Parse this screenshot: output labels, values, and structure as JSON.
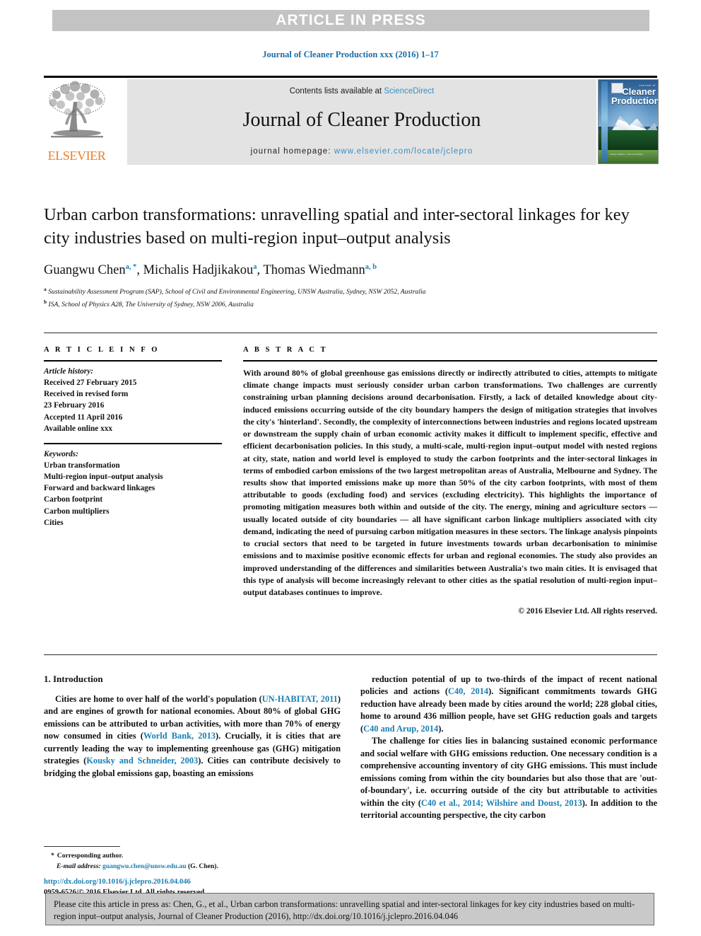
{
  "banner": {
    "text": "ARTICLE IN PRESS"
  },
  "running_head": "Journal of Cleaner Production xxx (2016) 1–17",
  "masthead": {
    "publisher_logo_label": "ELSEVIER",
    "contents_prefix": "Contents lists available at ",
    "contents_link": "ScienceDirect",
    "journal_name": "Journal of Cleaner Production",
    "homepage_prefix": "journal homepage: ",
    "homepage_url": "www.elsevier.com/locate/jclepro",
    "cover": {
      "eyebrow": "Journal of",
      "line1": "Cleaner",
      "line2": "Production",
      "footer_note": "Volume Summary  ·  Editorial Summary"
    }
  },
  "article": {
    "title": "Urban carbon transformations: unravelling spatial and inter-sectoral linkages for key city industries based on multi-region input–output analysis",
    "authors": [
      {
        "name": "Guangwu Chen",
        "marks": "a, *"
      },
      {
        "name": "Michalis Hadjikakou",
        "marks": "a"
      },
      {
        "name": "Thomas Wiedmann",
        "marks": "a, b"
      }
    ],
    "affiliations": [
      {
        "mark": "a",
        "text": "Sustainability Assessment Program (SAP), School of Civil and Environmental Engineering, UNSW Australia, Sydney, NSW 2052, Australia"
      },
      {
        "mark": "b",
        "text": "ISA, School of Physics A28, The University of Sydney, NSW 2006, Australia"
      }
    ]
  },
  "article_info": {
    "heading": "A R T I C L E  I N F O",
    "history_label": "Article history:",
    "history_lines": [
      "Received 27 February 2015",
      "Received in revised form",
      "23 February 2016",
      "Accepted 11 April 2016",
      "Available online xxx"
    ],
    "keywords_label": "Keywords:",
    "keywords": [
      "Urban transformation",
      "Multi-region input–output analysis",
      "Forward and backward linkages",
      "Carbon footprint",
      "Carbon multipliers",
      "Cities"
    ]
  },
  "abstract": {
    "heading": "A B S T R A C T",
    "text": "With around 80% of global greenhouse gas emissions directly or indirectly attributed to cities, attempts to mitigate climate change impacts must seriously consider urban carbon transformations. Two challenges are currently constraining urban planning decisions around decarbonisation. Firstly, a lack of detailed knowledge about city-induced emissions occurring outside of the city boundary hampers the design of mitigation strategies that involves the city's 'hinterland'. Secondly, the complexity of interconnections between industries and regions located upstream or downstream the supply chain of urban economic activity makes it difficult to implement specific, effective and efficient decarbonisation policies. In this study, a multi-scale, multi-region input–output model with nested regions at city, state, nation and world level is employed to study the carbon footprints and the inter-sectoral linkages in terms of embodied carbon emissions of the two largest metropolitan areas of Australia, Melbourne and Sydney. The results show that imported emissions make up more than 50% of the city carbon footprints, with most of them attributable to goods (excluding food) and services (excluding electricity). This highlights the importance of promoting mitigation measures both within and outside of the city. The energy, mining and agriculture sectors — usually located outside of city boundaries — all have significant carbon linkage multipliers associated with city demand, indicating the need of pursuing carbon mitigation measures in these sectors. The linkage analysis pinpoints to crucial sectors that need to be targeted in future investments towards urban decarbonisation to minimise emissions and to maximise positive economic effects for urban and regional economies. The study also provides an improved understanding of the differences and similarities between Australia's two main cities. It is envisaged that this type of analysis will become increasingly relevant to other cities as the spatial resolution of multi-region input–output databases continues to improve.",
    "copyright": "© 2016 Elsevier Ltd. All rights reserved."
  },
  "introduction": {
    "heading": "1. Introduction",
    "left_paragraph_1_parts": [
      {
        "t": "Cities are home to over half of the world's population (",
        "k": "plain"
      },
      {
        "t": "UN-HABITAT, 2011",
        "k": "cite"
      },
      {
        "t": ") and are engines of growth for national economies. About 80% of global GHG emissions can be attributed to urban activities, with more than 70% of energy now consumed in cities (",
        "k": "plain"
      },
      {
        "t": "World Bank, 2013",
        "k": "cite"
      },
      {
        "t": "). Crucially, it is cities that are currently leading the way to implementing greenhouse gas (GHG) mitigation strategies (",
        "k": "plain"
      },
      {
        "t": "Kousky and Schneider, 2003",
        "k": "cite"
      },
      {
        "t": "). Cities can contribute decisively to bridging the global emissions gap, boasting an emissions",
        "k": "plain"
      }
    ],
    "right_paragraph_1_parts": [
      {
        "t": "reduction potential of up to two-thirds of the impact of recent national policies and actions (",
        "k": "plain"
      },
      {
        "t": "C40, 2014",
        "k": "cite"
      },
      {
        "t": "). Significant commitments towards GHG reduction have already been made by cities around the world; 228 global cities, home to around 436 million people, have set GHG reduction goals and targets (",
        "k": "plain"
      },
      {
        "t": "C40 and Arup, 2014",
        "k": "cite"
      },
      {
        "t": ").",
        "k": "plain"
      }
    ],
    "right_paragraph_2_parts": [
      {
        "t": "The challenge for cities lies in balancing sustained economic performance and social welfare with GHG emissions reduction. One necessary condition is a comprehensive accounting inventory of city GHG emissions. This must include emissions coming from within the city boundaries but also those that are 'out-of-boundary', i.e. occurring outside of the city but attributable to activities within the city (",
        "k": "plain"
      },
      {
        "t": "C40 et al., 2014; Wilshire and Doust, 2013",
        "k": "cite"
      },
      {
        "t": "). In addition to the territorial accounting perspective, the city carbon",
        "k": "plain"
      }
    ]
  },
  "footnote": {
    "star": "*",
    "corresponding": "Corresponding author.",
    "email_label": "E-mail address:",
    "email": "guangwu.chen@unsw.edu.au",
    "email_suffix": "(G. Chen).",
    "doi_url": "http://dx.doi.org/10.1016/j.jclepro.2016.04.046",
    "issn_line": "0959-6526/© 2016 Elsevier Ltd. All rights reserved."
  },
  "cite_box": {
    "text": "Please cite this article in press as: Chen, G., et al., Urban carbon transformations: unravelling spatial and inter-sectoral linkages for key city industries based on multi-region input–output analysis, Journal of Cleaner Production (2016), http://dx.doi.org/10.1016/j.jclepro.2016.04.046"
  },
  "colors": {
    "link": "#1a7fb5",
    "banner_bg": "#c3c3c3",
    "masthead_bg": "#e3e3e3",
    "elsevier_orange": "#ef7d22",
    "cite_box_bg": "#c9c9c9"
  }
}
